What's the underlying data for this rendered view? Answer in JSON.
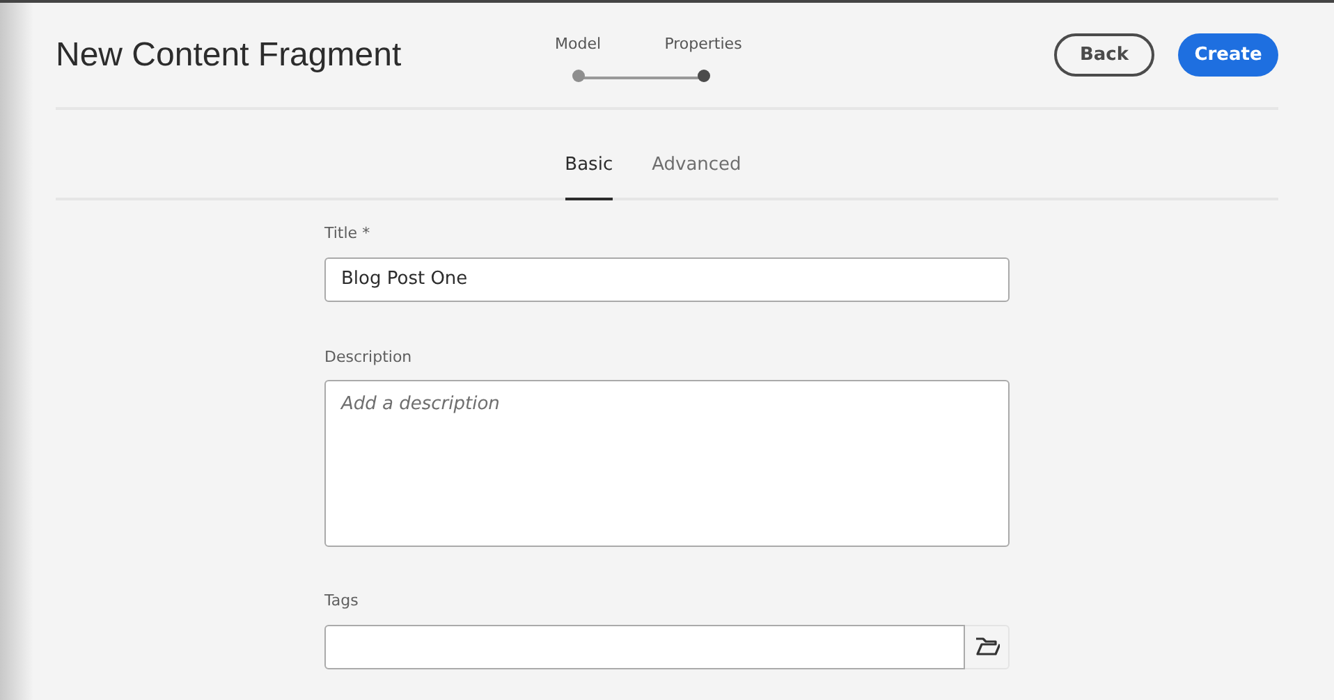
{
  "header": {
    "title": "New Content Fragment"
  },
  "steps": [
    {
      "label": "Model",
      "selected": false
    },
    {
      "label": "Properties",
      "selected": true
    }
  ],
  "buttons": [
    {
      "label": "Back",
      "kind": "secondary"
    },
    {
      "label": "Create",
      "kind": "primary"
    }
  ],
  "tabs": [
    {
      "label": "Basic",
      "selected": true
    },
    {
      "label": "Advanced",
      "selected": false
    }
  ],
  "fields": [
    {
      "label": "Title *",
      "kind": "text",
      "value": "Blog Post One"
    },
    {
      "label": "Description",
      "kind": "textarea",
      "placeholder": "Add a description"
    },
    {
      "label": "Tags",
      "kind": "picker"
    }
  ]
}
